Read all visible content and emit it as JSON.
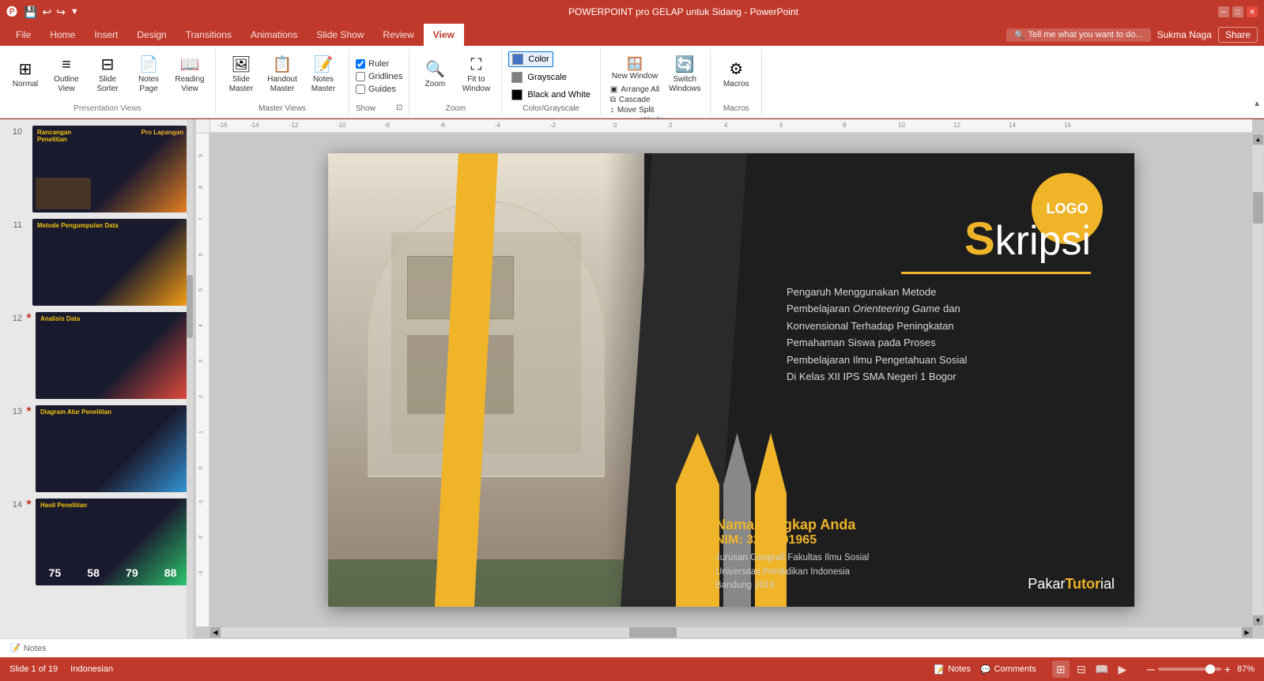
{
  "window": {
    "title": "POWERPOINT pro GELAP untuk Sidang - PowerPoint",
    "controls": [
      "minimize",
      "maximize",
      "close"
    ]
  },
  "ribbon": {
    "tabs": [
      {
        "id": "file",
        "label": "File"
      },
      {
        "id": "home",
        "label": "Home"
      },
      {
        "id": "insert",
        "label": "Insert"
      },
      {
        "id": "design",
        "label": "Design"
      },
      {
        "id": "transitions",
        "label": "Transitions"
      },
      {
        "id": "animations",
        "label": "Animations"
      },
      {
        "id": "slideshow",
        "label": "Slide Show"
      },
      {
        "id": "review",
        "label": "Review"
      },
      {
        "id": "view",
        "label": "View",
        "active": true
      }
    ],
    "groups": {
      "presentation_views": {
        "label": "Presentation Views",
        "buttons": [
          {
            "id": "normal",
            "label": "Normal",
            "icon": "⊞"
          },
          {
            "id": "outline-view",
            "label": "Outline View",
            "icon": "≡"
          },
          {
            "id": "slide-sorter",
            "label": "Slide Sorter",
            "icon": "⊟"
          },
          {
            "id": "notes-page",
            "label": "Notes Page",
            "icon": "📄"
          },
          {
            "id": "reading-view",
            "label": "Reading View",
            "icon": "📖"
          }
        ]
      },
      "master_views": {
        "label": "Master Views",
        "buttons": [
          {
            "id": "slide-master",
            "label": "Slide Master",
            "icon": "🖼"
          },
          {
            "id": "handout-master",
            "label": "Handout Master",
            "icon": "📋"
          },
          {
            "id": "notes-master",
            "label": "Notes Master",
            "icon": "📝"
          }
        ]
      },
      "show": {
        "label": "Show",
        "checkboxes": [
          {
            "id": "ruler",
            "label": "Ruler",
            "checked": true
          },
          {
            "id": "gridlines",
            "label": "Gridlines",
            "checked": false
          },
          {
            "id": "guides",
            "label": "Guides",
            "checked": false
          }
        ]
      },
      "zoom": {
        "label": "Zoom",
        "buttons": [
          {
            "id": "zoom",
            "label": "Zoom",
            "icon": "🔍"
          },
          {
            "id": "fit-to-window",
            "label": "Fit to Window",
            "icon": "⛶"
          }
        ]
      },
      "color_grayscale": {
        "label": "Color/Grayscale",
        "options": [
          {
            "id": "color",
            "label": "Color",
            "active": true
          },
          {
            "id": "grayscale",
            "label": "Grayscale"
          },
          {
            "id": "black-and-white",
            "label": "Black and White"
          }
        ]
      },
      "window": {
        "label": "Window",
        "buttons": [
          {
            "id": "new-window",
            "label": "New Window",
            "icon": "🪟"
          },
          {
            "id": "arrange-all",
            "label": "Arrange All"
          },
          {
            "id": "cascade",
            "label": "Cascade"
          },
          {
            "id": "move-split",
            "label": "Move Split"
          },
          {
            "id": "switch-windows",
            "label": "Switch Windows",
            "icon": "🔄"
          }
        ]
      },
      "macros": {
        "label": "Macros",
        "buttons": [
          {
            "id": "macros",
            "label": "Macros",
            "icon": "⚙"
          }
        ]
      }
    }
  },
  "tell_me": {
    "placeholder": "Tell me what you want to do..."
  },
  "user": {
    "name": "Sukma Naga",
    "share_label": "Share"
  },
  "quick_access": {
    "buttons": [
      "save",
      "undo",
      "redo",
      "customize"
    ]
  },
  "slide_panel": {
    "slides": [
      {
        "num": "10",
        "starred": false,
        "title": "Rancangan Penelitian",
        "bg": "thumb-10"
      },
      {
        "num": "11",
        "starred": false,
        "title": "Metode Pengumpulan Data",
        "bg": "thumb-11"
      },
      {
        "num": "12",
        "starred": true,
        "title": "Analisis Data",
        "bg": "thumb-12"
      },
      {
        "num": "13",
        "starred": true,
        "title": "Diagram Alur Penelitian",
        "bg": "thumb-13"
      },
      {
        "num": "14",
        "starred": true,
        "title": "Hasil Penelitian",
        "bg": "thumb-14"
      }
    ]
  },
  "slide": {
    "logo": "LOGO",
    "title_prefix": "S",
    "title_suffix": "kripsi",
    "title_underline": true,
    "subtitle_line1": "Pengaruh Menggunakan Metode",
    "subtitle_line2": "Pembelajaran ",
    "subtitle_italic": "Orienteering Game",
    "subtitle_line3": " dan",
    "subtitle_line4": "Konvensional Terhadap Peningkatan",
    "subtitle_line5": "Pemahaman Siswa pada Proses",
    "subtitle_line6": "Pembelajaran Ilmu Pengetahuan Sosial",
    "subtitle_line7": "Di Kelas XII IPS SMA Negeri 1 Bogor",
    "name": "Nama Lengkap Anda",
    "nim": "NIM: 3201401965",
    "institution1": "Jurusan Geografi  Fakultas Ilmu Sosial",
    "institution2": "Universitas Pendidikan Indonesia",
    "institution3": "Bandung 2019",
    "watermark_prefix": "Pakar",
    "watermark_suffix": "Tutorial"
  },
  "notes_bar": {
    "label": "Notes"
  },
  "status_bar": {
    "slide_info": "Slide 1 of 19",
    "language": "Indonesian",
    "notes_label": "Notes",
    "comments_label": "Comments",
    "zoom_level": "87%",
    "views": [
      "normal",
      "slide-sorter",
      "reading"
    ]
  }
}
